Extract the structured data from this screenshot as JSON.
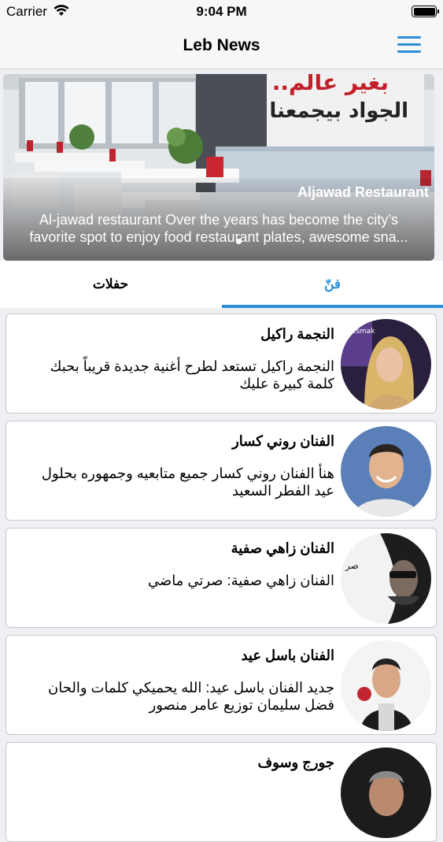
{
  "status_bar": {
    "carrier": "Carrier",
    "time": "9:04 PM"
  },
  "nav": {
    "title": "Leb News",
    "menu_icon": "hamburger-menu-icon"
  },
  "banner": {
    "sign_line1": "..بغير عالم",
    "sign_line2": "الجواد بيجمعنا",
    "title": "Aljawad Restaurant",
    "description_line1": "Al-jawad restaurant Over the years has become the city’s",
    "description_line2": "favorite spot to enjoy food restaurant plates, awesome sna..."
  },
  "tabs": [
    {
      "label": "حفلات",
      "selected": false
    },
    {
      "label": "فنّ",
      "selected": true
    }
  ],
  "accent_color": "#2b8fd8",
  "articles": [
    {
      "title": "النجمة راكيل",
      "line1": "النجمة راكيل تستعد لطرح أغنية جديدة قريباً بحبك",
      "line2": "كلمة كبيرة عليك",
      "avatar_caption": "Bi Esmak"
    },
    {
      "title": "الفنان روني كسار",
      "line1": "هنأ الفنان روني كسار جميع متابعيه وجمهوره بحلول",
      "line2": "عيد الفطر السعيد",
      "avatar_caption": ""
    },
    {
      "title": "الفنان زاهي صفية",
      "line1": "الفنان زاهي صفية: صرتي ماضي",
      "line2": "",
      "avatar_caption": "صر"
    },
    {
      "title": "الفنان باسل عيد",
      "line1": "جديد الفنان باسل عيد: الله يحميكي  كلمات والحان",
      "line2": "فضل سليمان  توزيع عامر منصور",
      "avatar_caption": ""
    },
    {
      "title": "جورج وسوف",
      "line1": "",
      "line2": "",
      "avatar_caption": ""
    }
  ]
}
